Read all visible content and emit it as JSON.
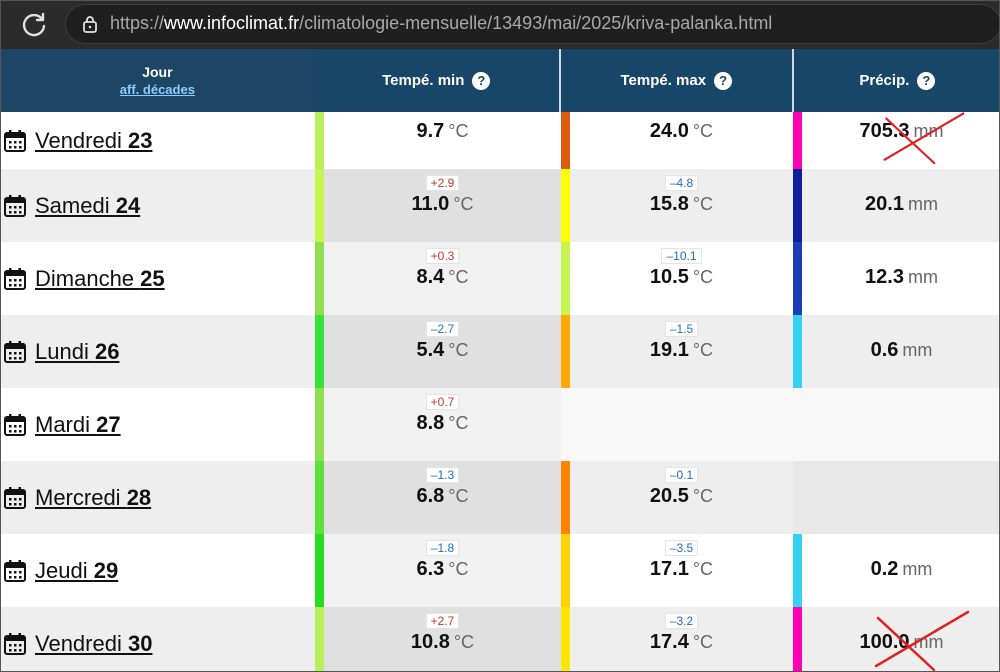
{
  "browser": {
    "url_prefix": "https://",
    "url_host": "www.infoclimat.fr",
    "url_path": "/climatologie-mensuelle/13493/mai/2025/kriva-palanka.html"
  },
  "header": {
    "day": "Jour",
    "day_link": "aff. décades",
    "min": "Tempé. min",
    "max": "Tempé. max",
    "precip": "Précip.",
    "help": "?"
  },
  "units": {
    "temp": "°C",
    "precip": "mm"
  },
  "colors": {
    "header_bg": "#174668",
    "header_day_bg": "#1c4664",
    "link": "#8ecbff",
    "positive_deviation": "#c0392b",
    "negative_deviation": "#1f6fbf",
    "strike": "#e02020"
  },
  "rows": [
    {
      "day_name": "Vendredi",
      "day_num": "23",
      "min": "9.7",
      "min_dev": "",
      "min_color": "#b7f05a",
      "max": "24.0",
      "max_dev": "",
      "max_color": "#de5a0c",
      "precip": "705.3",
      "precip_color": "#ff00b4",
      "precip_struck": true
    },
    {
      "day_name": "Samedi",
      "day_num": "24",
      "min": "11.0",
      "min_dev": "+2.9",
      "min_color": "#c6f552",
      "max": "15.8",
      "max_dev": "–4.8",
      "max_color": "#ffff00",
      "precip": "20.1",
      "precip_color": "#0d1e9e",
      "precip_struck": false
    },
    {
      "day_name": "Dimanche",
      "day_num": "25",
      "min": "8.4",
      "min_dev": "+0.3",
      "min_color": "#8fe050",
      "max": "10.5",
      "max_dev": "–10.1",
      "max_color": "#c6f552",
      "precip": "12.3",
      "precip_color": "#1a3db8",
      "precip_struck": false
    },
    {
      "day_name": "Lundi",
      "day_num": "26",
      "min": "5.4",
      "min_dev": "–2.7",
      "min_color": "#38e03a",
      "max": "19.1",
      "max_dev": "–1.5",
      "max_color": "#ffa800",
      "precip": "0.6",
      "precip_color": "#32d2f0",
      "precip_struck": false
    },
    {
      "day_name": "Mardi",
      "day_num": "27",
      "min": "8.8",
      "min_dev": "+0.7",
      "min_color": "#8fe050",
      "max": "",
      "max_dev": "",
      "max_color": "",
      "precip": "",
      "precip_color": "",
      "precip_struck": false
    },
    {
      "day_name": "Mercredi",
      "day_num": "28",
      "min": "6.8",
      "min_dev": "–1.3",
      "min_color": "#5ee03a",
      "max": "20.5",
      "max_dev": "–0.1",
      "max_color": "#ff8200",
      "precip": "",
      "precip_color": "",
      "precip_struck": false
    },
    {
      "day_name": "Jeudi",
      "day_num": "29",
      "min": "6.3",
      "min_dev": "–1.8",
      "min_color": "#28dc1e",
      "max": "17.1",
      "max_dev": "–3.5",
      "max_color": "#ffd200",
      "precip": "0.2",
      "precip_color": "#32d2f0",
      "precip_struck": false
    },
    {
      "day_name": "Vendredi",
      "day_num": "30",
      "min": "10.8",
      "min_dev": "+2.7",
      "min_color": "#b7f05a",
      "max": "17.4",
      "max_dev": "–3.2",
      "max_color": "#ffe600",
      "precip": "100.0",
      "precip_color": "#ff00b4",
      "precip_struck": true
    }
  ]
}
